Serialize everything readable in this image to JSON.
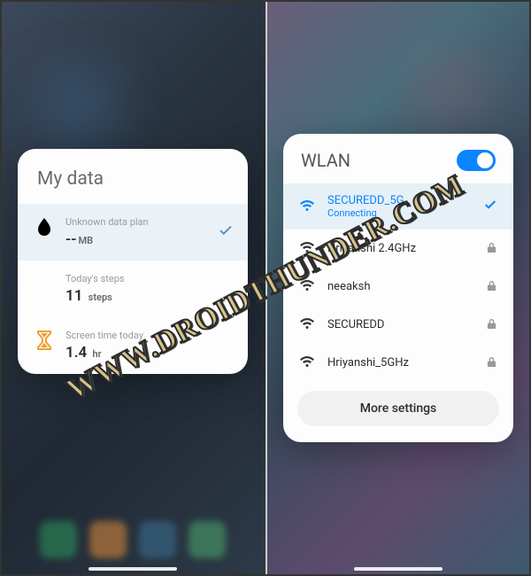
{
  "watermark": "WWW.DROIDTHUNDER.COM",
  "left": {
    "card_title": "My data",
    "data_plan": {
      "label": "Unknown data plan",
      "value": "--",
      "unit": "MB"
    },
    "steps": {
      "label": "Today's steps",
      "value": "11",
      "unit": "steps"
    },
    "screen_time": {
      "label": "Screen time today",
      "value": "1.4",
      "unit": "hr"
    }
  },
  "right": {
    "title": "WLAN",
    "toggle_on": true,
    "connecting_status": "Connecting",
    "networks": [
      {
        "name": "SECUREDD_5G",
        "status": "Connecting",
        "locked": false,
        "active": true
      },
      {
        "name": "Hriyanshi 2.4GHz",
        "status": "",
        "locked": true,
        "active": false
      },
      {
        "name": "neeaksh",
        "status": "",
        "locked": true,
        "active": false
      },
      {
        "name": "SECUREDD",
        "status": "",
        "locked": true,
        "active": false
      },
      {
        "name": "Hriyanshi_5GHz",
        "status": "",
        "locked": true,
        "active": false
      }
    ],
    "more_button": "More settings"
  }
}
